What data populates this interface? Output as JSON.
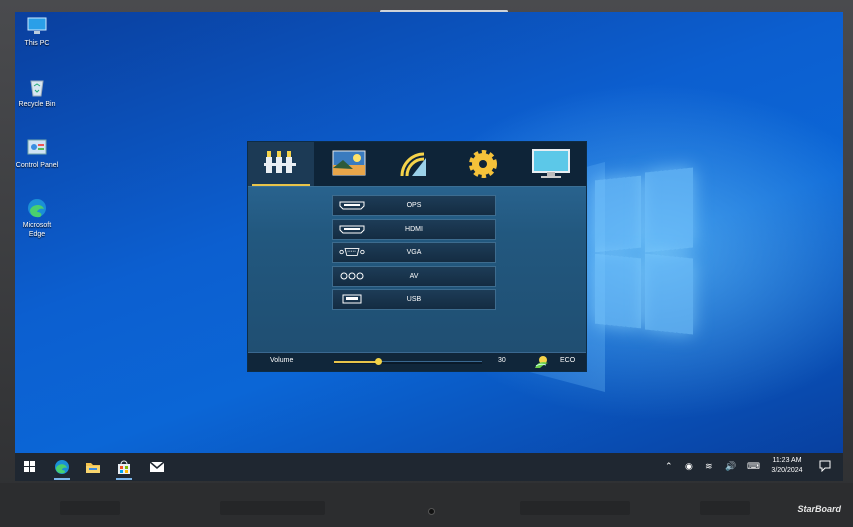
{
  "desktop": {
    "icons": [
      {
        "label": "This PC",
        "icon": "this-pc-icon"
      },
      {
        "label": "Recycle Bin",
        "icon": "recycle-bin-icon"
      },
      {
        "label": "Control Panel",
        "icon": "control-panel-icon"
      },
      {
        "label": "Microsoft Edge",
        "icon": "edge-icon"
      }
    ]
  },
  "osd": {
    "tabs": [
      {
        "icon": "input-source-icon",
        "active": true
      },
      {
        "icon": "picture-icon",
        "active": false
      },
      {
        "icon": "sound-icon",
        "active": false
      },
      {
        "icon": "settings-gear-icon",
        "active": false
      },
      {
        "icon": "display-icon",
        "active": false
      }
    ],
    "sources": [
      {
        "label": "OPS",
        "icon": "hdmi-port-icon"
      },
      {
        "label": "HDMI",
        "icon": "hdmi-port-icon"
      },
      {
        "label": "VGA",
        "icon": "vga-port-icon"
      },
      {
        "label": "AV",
        "icon": "av-port-icon"
      },
      {
        "label": "USB",
        "icon": "usb-port-icon"
      }
    ],
    "volume": {
      "label": "Volume",
      "value": "30",
      "level": 0.3
    },
    "eco": {
      "label": "ECO",
      "icon": "eco-leaf-icon"
    }
  },
  "taskbar": {
    "apps": [
      "start-icon",
      "edge-icon",
      "file-explorer-icon",
      "store-icon",
      "mail-icon"
    ],
    "tray": [
      "chevron-up-icon",
      "meet-icon",
      "wifi-icon",
      "volume-icon",
      "keyboard-icon"
    ],
    "time": "11:23 AM",
    "date": "3/20/2024",
    "notification_icon": "notification-icon"
  },
  "bezel": {
    "brand": "StarBoard"
  },
  "colors": {
    "accent": "#e8c44a",
    "osd_bg": "#22587f",
    "taskbar": "#1f2731",
    "desktop": "#0c5fd0"
  }
}
